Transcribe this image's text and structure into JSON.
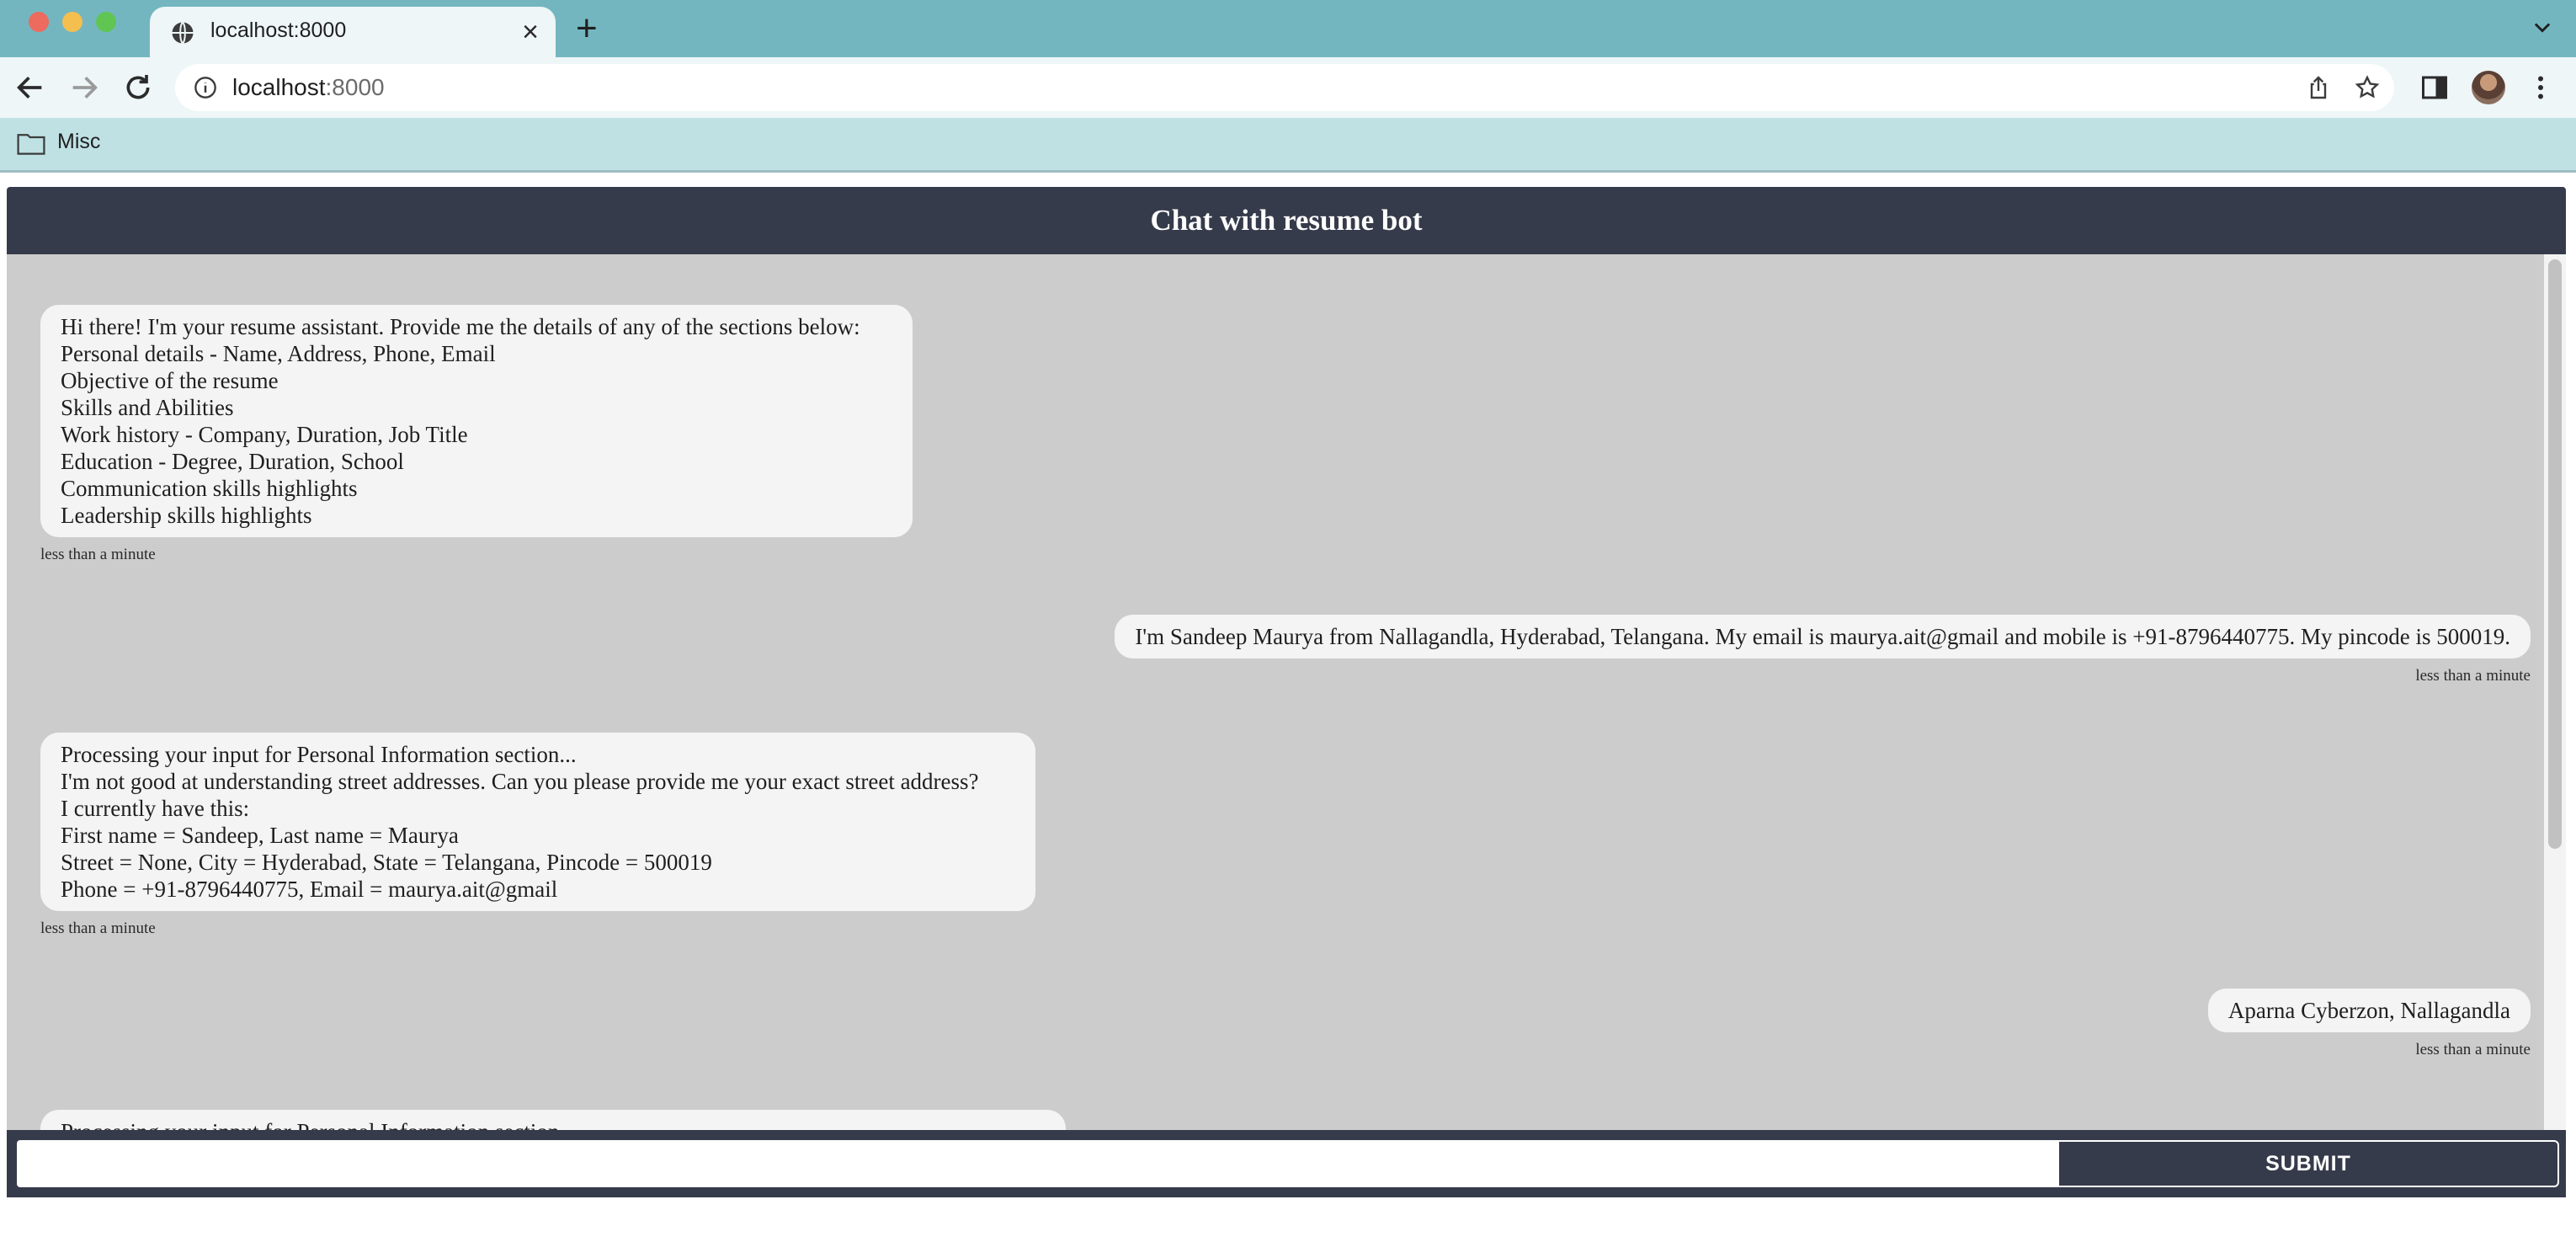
{
  "browser": {
    "tab_title": "localhost:8000",
    "url_host": "localhost",
    "url_port": ":8000",
    "bookmarks": [
      {
        "label": "Misc"
      }
    ]
  },
  "app": {
    "title": "Chat with resume bot",
    "messages": [
      {
        "sender": "bot",
        "lines": [
          "Hi there! I'm your resume assistant. Provide me the details of any of the sections below:",
          "Personal details - Name, Address, Phone, Email",
          "Objective of the resume",
          "Skills and Abilities",
          "Work history - Company, Duration, Job Title",
          "Education - Degree, Duration, School",
          "Communication skills highlights",
          "Leadership skills highlights"
        ],
        "time": "less than a minute"
      },
      {
        "sender": "user",
        "lines": [
          "I'm Sandeep Maurya from Nallagandla, Hyderabad, Telangana. My email is maurya.ait@gmail and mobile is +91-8796440775. My pincode is 500019."
        ],
        "time": "less than a minute"
      },
      {
        "sender": "bot",
        "lines": [
          "Processing your input for Personal Information section...",
          "I'm not good at understanding street addresses. Can you please provide me your exact street address?",
          "I currently have this:",
          "First name = Sandeep, Last name = Maurya",
          "Street = None, City = Hyderabad, State = Telangana, Pincode = 500019",
          "Phone = +91-8796440775, Email = maurya.ait@gmail"
        ],
        "time": "less than a minute"
      },
      {
        "sender": "user",
        "lines": [
          "Aparna Cyberzon, Nallagandla"
        ],
        "time": "less than a minute"
      },
      {
        "sender": "bot",
        "lines": [
          "Processing your input for Personal Information section..."
        ]
      }
    ],
    "input": {
      "value": "",
      "placeholder": ""
    },
    "submit_label": "SUBMIT"
  },
  "colors": {
    "tabstrip": "#74b6c0",
    "toolbar": "#eef6f7",
    "bookmark_bar": "#bfe1e4",
    "app_header": "#363b4b",
    "chat_background": "#cccccc",
    "bubble": "#f4f4f4"
  }
}
